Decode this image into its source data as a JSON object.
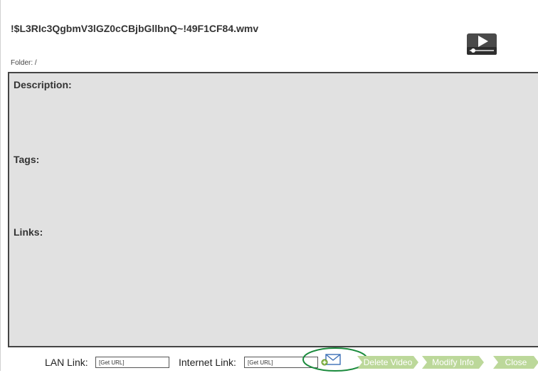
{
  "file": {
    "title": "!$L3RIc3QgbmV3lGZ0cCBjbGllbnQ~!49F1CF84.wmv",
    "folder_label": "Folder:",
    "folder_value": "/"
  },
  "icons": {
    "video": "video-play-icon",
    "email": "email-icon"
  },
  "info": {
    "description_label": "Description:",
    "description_value": "",
    "tags_label": "Tags:",
    "tags_value": "",
    "links_label": "Links:",
    "links_value": ""
  },
  "footer": {
    "lan_label": "LAN Link:",
    "lan_value": "[Get URL]",
    "internet_label": "Internet Link:",
    "internet_value": "[Get URL]",
    "delete_label": "Delete Video",
    "modify_label": "Modify Info",
    "close_label": "Close"
  },
  "colors": {
    "panel_bg": "#e1e1e1",
    "button_green": "#bcd89a",
    "highlight": "#1a8a3c"
  }
}
